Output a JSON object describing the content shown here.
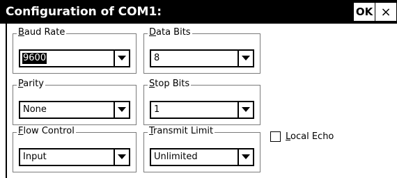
{
  "window": {
    "title": "Configuration of COM1:",
    "ok_label": "OK",
    "close_label": "×"
  },
  "groups": {
    "baud_rate": {
      "mnemonic": "B",
      "label_rest": "aud Rate",
      "value": "9600",
      "arrow_icon": "chevron-down-icon"
    },
    "data_bits": {
      "mnemonic": "D",
      "label_rest": "ata Bits",
      "value": "8",
      "arrow_icon": "chevron-down-icon"
    },
    "parity": {
      "mnemonic": "P",
      "label_rest": "arity",
      "value": "None",
      "arrow_icon": "chevron-down-icon"
    },
    "stop_bits": {
      "mnemonic": "S",
      "label_rest": "top Bits",
      "value": "1",
      "arrow_icon": "chevron-down-icon"
    },
    "flow_control": {
      "mnemonic": "F",
      "label_rest": "low Control",
      "value": "Input",
      "arrow_icon": "chevron-down-icon"
    },
    "transmit_limit": {
      "mnemonic": "T",
      "label_rest": "ransmit Limit",
      "value": "Unlimited",
      "arrow_icon": "chevron-down-icon"
    }
  },
  "local_echo": {
    "mnemonic": "L",
    "label_rest": "ocal Echo",
    "checked": false
  },
  "colors": {
    "titlebar": "#000000",
    "background": "#ffffff",
    "selection": "#000000"
  }
}
